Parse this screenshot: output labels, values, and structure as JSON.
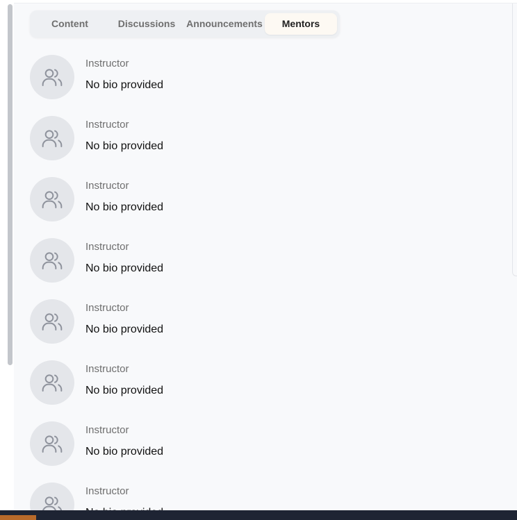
{
  "tabs": [
    {
      "label": "Content",
      "active": false
    },
    {
      "label": "Discussions",
      "active": false
    },
    {
      "label": "Announcements",
      "active": false
    },
    {
      "label": "Mentors",
      "active": true
    }
  ],
  "mentors": [
    {
      "role": "Instructor",
      "bio": "No bio provided",
      "icon": "users-icon"
    },
    {
      "role": "Instructor",
      "bio": "No bio provided",
      "icon": "users-icon"
    },
    {
      "role": "Instructor",
      "bio": "No bio provided",
      "icon": "users-icon"
    },
    {
      "role": "Instructor",
      "bio": "No bio provided",
      "icon": "users-icon"
    },
    {
      "role": "Instructor",
      "bio": "No bio provided",
      "icon": "users-icon"
    },
    {
      "role": "Instructor",
      "bio": "No bio provided",
      "icon": "users-icon"
    },
    {
      "role": "Instructor",
      "bio": "No bio provided",
      "icon": "users-icon"
    },
    {
      "role": "Instructor",
      "bio": "No bio provided",
      "icon": "users-icon"
    }
  ],
  "colors": {
    "active_tab_bg": "#fdf9f3",
    "avatar_bg": "#e4e6ea",
    "icon_stroke": "#8e929c"
  }
}
